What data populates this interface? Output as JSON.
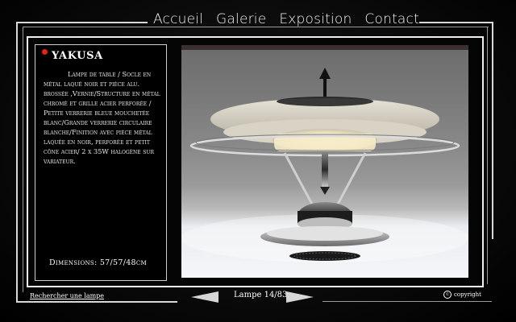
{
  "nav": {
    "items": [
      {
        "label": "Accueil"
      },
      {
        "label": "Galerie"
      },
      {
        "label": "Exposition"
      },
      {
        "label": "Contact"
      }
    ]
  },
  "product": {
    "name": "YAKUSA",
    "description": "Lampe de table / Socle en métal laqué noir et pièce alu. brossée ,Vernie/Structure en métal chromé et grille acier perforée / Petite verrerie bleue mouchetée blanc/Grande verrerie circulaire blanche/Finition avec pièce métal laquée en noir, perforée et petit cône acier/ 2 x 35W halogène sur variateur.",
    "dimensions": "Dimensions: 57/57/48cm"
  },
  "footer": {
    "search_link": "Rechercher une lampe",
    "pager_label": "Lampe 14/83",
    "copyright": "copyright"
  },
  "colors": {
    "accent_dot": "#e2231a",
    "frame": "#f0f0f0",
    "background": "#000000"
  },
  "icons": {
    "prev": "prev-arrow-icon",
    "next": "next-arrow-icon",
    "copyright": "copyright-icon"
  }
}
